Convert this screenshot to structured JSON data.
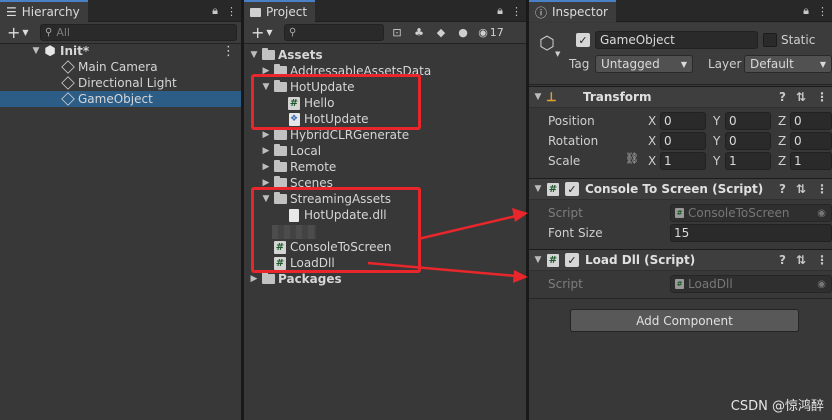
{
  "hierarchy": {
    "tab_label": "Hierarchy",
    "search_placeholder": "All",
    "scene_name": "Init*",
    "items": [
      "Main Camera",
      "Directional Light",
      "GameObject"
    ]
  },
  "project": {
    "tab_label": "Project",
    "hidden_count": "17",
    "root": "Assets",
    "items": {
      "addressable": "AddressableAssetsData",
      "hotupdate": "HotUpdate",
      "hello": "Hello",
      "hotupdate_asm": "HotUpdate",
      "hybridclr": "HybridCLRGenerate",
      "local": "Local",
      "remote": "Remote",
      "scenes": "Scenes",
      "streaming": "StreamingAssets",
      "dll": "HotUpdate.dll",
      "console": "ConsoleToScreen",
      "loaddll": "LoadDll",
      "packages": "Packages"
    }
  },
  "inspector": {
    "tab_label": "Inspector",
    "object_name": "GameObject",
    "static_label": "Static",
    "tag_label": "Tag",
    "tag_value": "Untagged",
    "layer_label": "Layer",
    "layer_value": "Default",
    "transform": {
      "title": "Transform",
      "position_label": "Position",
      "rotation_label": "Rotation",
      "scale_label": "Scale",
      "x": "X",
      "y": "Y",
      "z": "Z",
      "position": [
        "0",
        "0",
        "0"
      ],
      "rotation": [
        "0",
        "0",
        "0"
      ],
      "scale": [
        "1",
        "1",
        "1"
      ]
    },
    "console_comp": {
      "title": "Console To Screen (Script)",
      "script_label": "Script",
      "script_value": "ConsoleToScreen",
      "font_label": "Font Size",
      "font_value": "15"
    },
    "loaddll_comp": {
      "title": "Load Dll (Script)",
      "script_label": "Script",
      "script_value": "LoadDll"
    },
    "add_component": "Add Component"
  },
  "watermark": "CSDN @惊鸿醉",
  "colors": {
    "highlight": "#e8262b",
    "selection": "#2c5d87",
    "tab_accent": "#4a80c4"
  }
}
